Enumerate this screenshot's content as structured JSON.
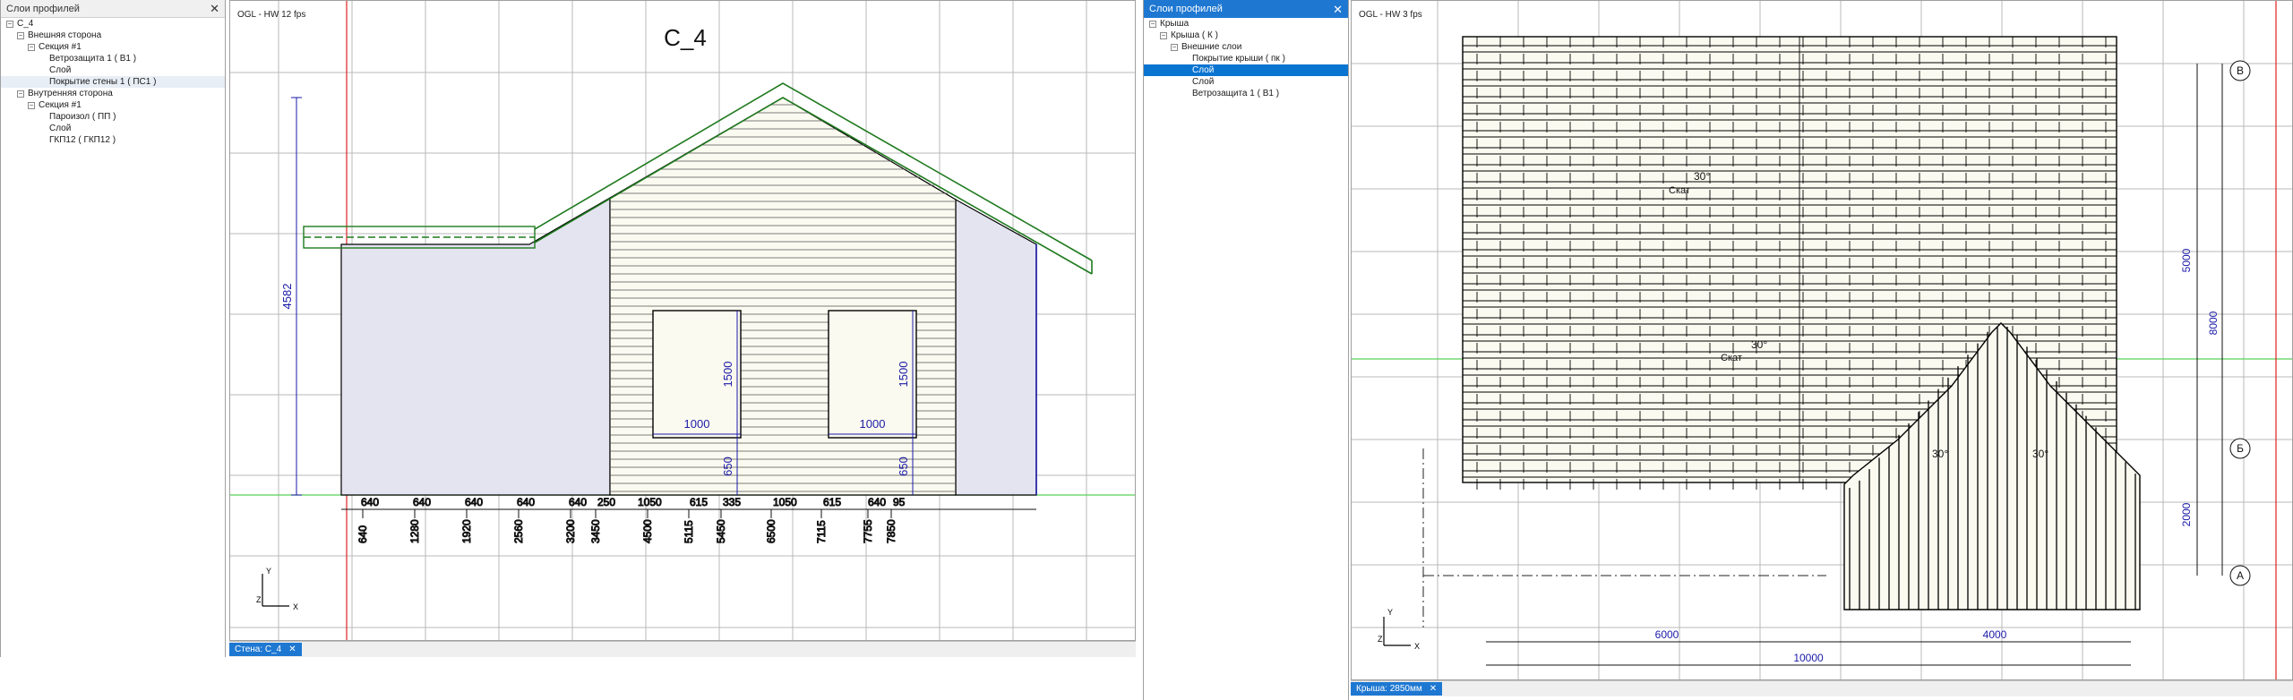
{
  "left_panel": {
    "title": "Слои профилей",
    "tree": [
      {
        "label": "С_4",
        "indent": 0,
        "expander": "-"
      },
      {
        "label": "Внешняя сторона",
        "indent": 1,
        "expander": "-"
      },
      {
        "label": "Секция #1",
        "indent": 2,
        "expander": "-"
      },
      {
        "label": "Ветрозащита 1 ( В1 )",
        "indent": 3,
        "expander": ""
      },
      {
        "label": "Слой",
        "indent": 3,
        "expander": ""
      },
      {
        "label": "Покрытие стены 1 ( ПС1 )",
        "indent": 3,
        "expander": "",
        "highlight": true
      },
      {
        "label": "Внутренняя сторона",
        "indent": 1,
        "expander": "-"
      },
      {
        "label": "Секция #1",
        "indent": 2,
        "expander": "-"
      },
      {
        "label": "Пароизол ( ПП )",
        "indent": 3,
        "expander": ""
      },
      {
        "label": "Слой",
        "indent": 3,
        "expander": ""
      },
      {
        "label": "ГКП12 ( ГКП12 )",
        "indent": 3,
        "expander": ""
      }
    ]
  },
  "left_view": {
    "label": "OGL - HW  12 fps",
    "title": "С_4",
    "tab": "Стена: С_4",
    "dims_top": [
      "640",
      "640",
      "640",
      "640",
      "640",
      "250",
      "1050",
      "615",
      "335",
      "1050",
      "615",
      "640",
      "95"
    ],
    "dims_rot": [
      "640",
      "1280",
      "1920",
      "2560",
      "3200",
      "3450",
      "4500",
      "5115",
      "5450",
      "6500",
      "7115",
      "7755",
      "7850"
    ],
    "height_dim": "4582",
    "win_h": "1500",
    "win_w": "1000",
    "sill": "650",
    "axis_x": "X",
    "axis_y": "Y",
    "axis_z": "Z"
  },
  "right_panel": {
    "title": "Слои профилей",
    "tree": [
      {
        "label": "Крыша",
        "indent": 0,
        "expander": "-"
      },
      {
        "label": "Крыша ( К )",
        "indent": 1,
        "expander": "-"
      },
      {
        "label": "Внешние слои",
        "indent": 2,
        "expander": "-"
      },
      {
        "label": "Покрытие крыши ( пк )",
        "indent": 3,
        "expander": ""
      },
      {
        "label": "Слой",
        "indent": 3,
        "expander": "",
        "selected": true
      },
      {
        "label": "Слой",
        "indent": 3,
        "expander": ""
      },
      {
        "label": "Ветрозащита 1 ( В1 )",
        "indent": 3,
        "expander": ""
      }
    ]
  },
  "right_view": {
    "label": "OGL - HW  3 fps",
    "tab": "Крыша: 2850мм",
    "axis_b": "В",
    "axis_bsoft": "Б",
    "axis_a": "А",
    "dim_5000": "5000",
    "dim_8000": "8000",
    "dim_2000": "2000",
    "dim_6000": "6000",
    "dim_4000": "4000",
    "dim_10000": "10000",
    "slope1": "30°",
    "slope2": "30°",
    "slope3": "30°",
    "slope4": "30°",
    "slope_unit": "Скат",
    "axis_x": "X",
    "axis_y": "Y",
    "axis_z": "Z"
  },
  "colors": {
    "accent": "#1e78d2",
    "dim": "#1a1aa8",
    "roof_green": "#1f7a1f",
    "wall_fill": "#e4e4f0",
    "siding": "#fafaf0",
    "red_axis": "#e02020"
  }
}
